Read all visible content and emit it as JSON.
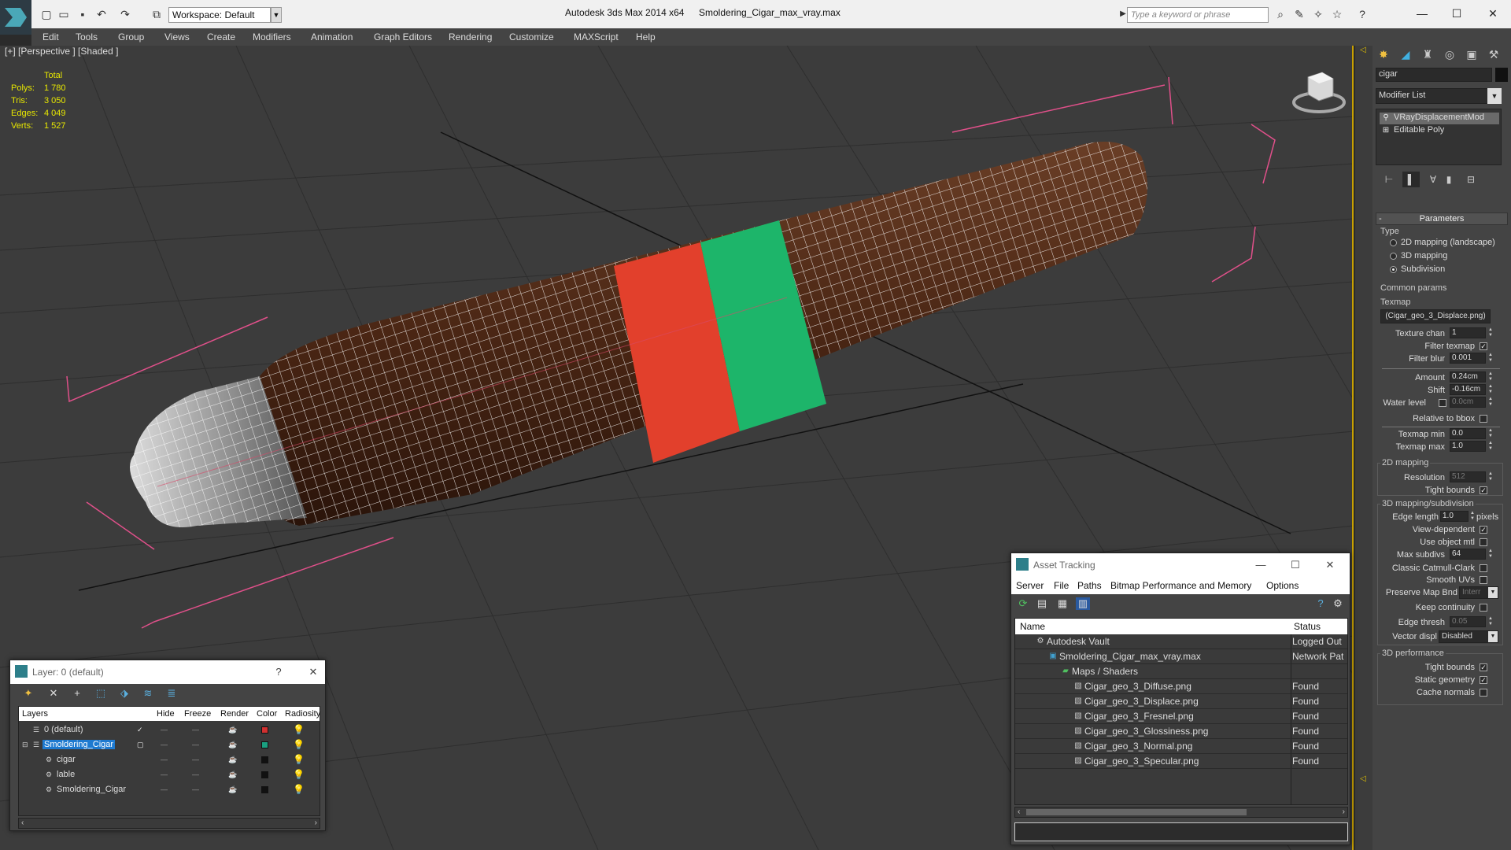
{
  "titlebar": {
    "workspace": "Workspace: Default",
    "app_title": "Autodesk 3ds Max  2014 x64",
    "file_title": "Smoldering_Cigar_max_vray.max",
    "search_placeholder": "Type a keyword or phrase"
  },
  "menubar": [
    "Edit",
    "Tools",
    "Group",
    "Views",
    "Create",
    "Modifiers",
    "Animation",
    "Graph Editors",
    "Rendering",
    "Customize",
    "MAXScript",
    "Help"
  ],
  "viewport": {
    "label": "[+] [Perspective ] [Shaded ]",
    "stats": {
      "header": "Total",
      "polys_label": "Polys:",
      "polys": "1 780",
      "tris_label": "Tris:",
      "tris": "3 050",
      "edges_label": "Edges:",
      "edges": "4 049",
      "verts_label": "Verts:",
      "verts": "1 527"
    }
  },
  "command_panel": {
    "object_name": "cigar",
    "modifier_list": "Modifier List",
    "stack": [
      "VRayDisplacementMod",
      "Editable Poly"
    ],
    "parameters_title": "Parameters",
    "type_label": "Type",
    "type_options": [
      "2D mapping (landscape)",
      "3D mapping",
      "Subdivision"
    ],
    "type_selected": "Subdivision",
    "common_params": "Common params",
    "texmap_label": "Texmap",
    "texmap_value": "(Cigar_geo_3_Displace.png)",
    "texture_chan_label": "Texture chan",
    "texture_chan": "1",
    "filter_texmap_label": "Filter texmap",
    "filter_blur_label": "Filter blur",
    "filter_blur": "0.001",
    "amount_label": "Amount",
    "amount": "0.24cm",
    "shift_label": "Shift",
    "shift": "-0.16cm",
    "water_level_label": "Water level",
    "water_level": "0.0cm",
    "relative_bbox_label": "Relative to bbox",
    "texmap_min_label": "Texmap min",
    "texmap_min": "0.0",
    "texmap_max_label": "Texmap max",
    "texmap_max": "1.0",
    "mapping2d_label": "2D mapping",
    "resolution_label": "Resolution",
    "resolution": "512",
    "tight_bounds_label": "Tight bounds",
    "mapping3d_label": "3D mapping/subdivision",
    "edge_length_label": "Edge length",
    "edge_length": "1.0",
    "pixels_label": "pixels",
    "view_dependent_label": "View-dependent",
    "use_object_mtl_label": "Use object mtl",
    "max_subdivs_label": "Max subdivs",
    "max_subdivs": "64",
    "catmull_label": "Classic Catmull-Clark",
    "smooth_uvs_label": "Smooth UVs",
    "preserve_label": "Preserve Map Bnd",
    "preserve_value": "Interr",
    "keep_continuity_label": "Keep continuity",
    "edge_thresh_label": "Edge thresh",
    "edge_thresh": "0.05",
    "vector_disp_label": "Vector displ",
    "vector_disp": "Disabled",
    "perf_label": "3D performance",
    "perf_tight_label": "Tight bounds",
    "static_geom_label": "Static geometry",
    "cache_normals_label": "Cache normals"
  },
  "layer_window": {
    "title": "Layer: 0 (default)",
    "help": "?",
    "columns": [
      "Layers",
      "Hide",
      "Freeze",
      "Render",
      "Color",
      "Radiosity"
    ],
    "rows": [
      {
        "name": "0 (default)",
        "color": "#d03030"
      },
      {
        "name": "Smoldering_Cigar",
        "color": "#1aa080"
      },
      {
        "name": "cigar",
        "color": "#111111"
      },
      {
        "name": "lable",
        "color": "#111111"
      },
      {
        "name": "Smoldering_Cigar",
        "color": "#111111"
      }
    ]
  },
  "asset_window": {
    "title": "Asset Tracking",
    "menu": [
      "Server",
      "File",
      "Paths",
      "Bitmap Performance and Memory",
      "Options"
    ],
    "columns": [
      "Name",
      "Status"
    ],
    "rows": [
      {
        "name": "Autodesk Vault",
        "status": "Logged Out",
        "indent": 0
      },
      {
        "name": "Smoldering_Cigar_max_vray.max",
        "status": "Network Pat",
        "indent": 1
      },
      {
        "name": "Maps / Shaders",
        "status": "",
        "indent": 2
      },
      {
        "name": "Cigar_geo_3_Diffuse.png",
        "status": "Found",
        "indent": 3
      },
      {
        "name": "Cigar_geo_3_Displace.png",
        "status": "Found",
        "indent": 3
      },
      {
        "name": "Cigar_geo_3_Fresnel.png",
        "status": "Found",
        "indent": 3
      },
      {
        "name": "Cigar_geo_3_Glossiness.png",
        "status": "Found",
        "indent": 3
      },
      {
        "name": "Cigar_geo_3_Normal.png",
        "status": "Found",
        "indent": 3
      },
      {
        "name": "Cigar_geo_3_Specular.png",
        "status": "Found",
        "indent": 3
      }
    ]
  }
}
